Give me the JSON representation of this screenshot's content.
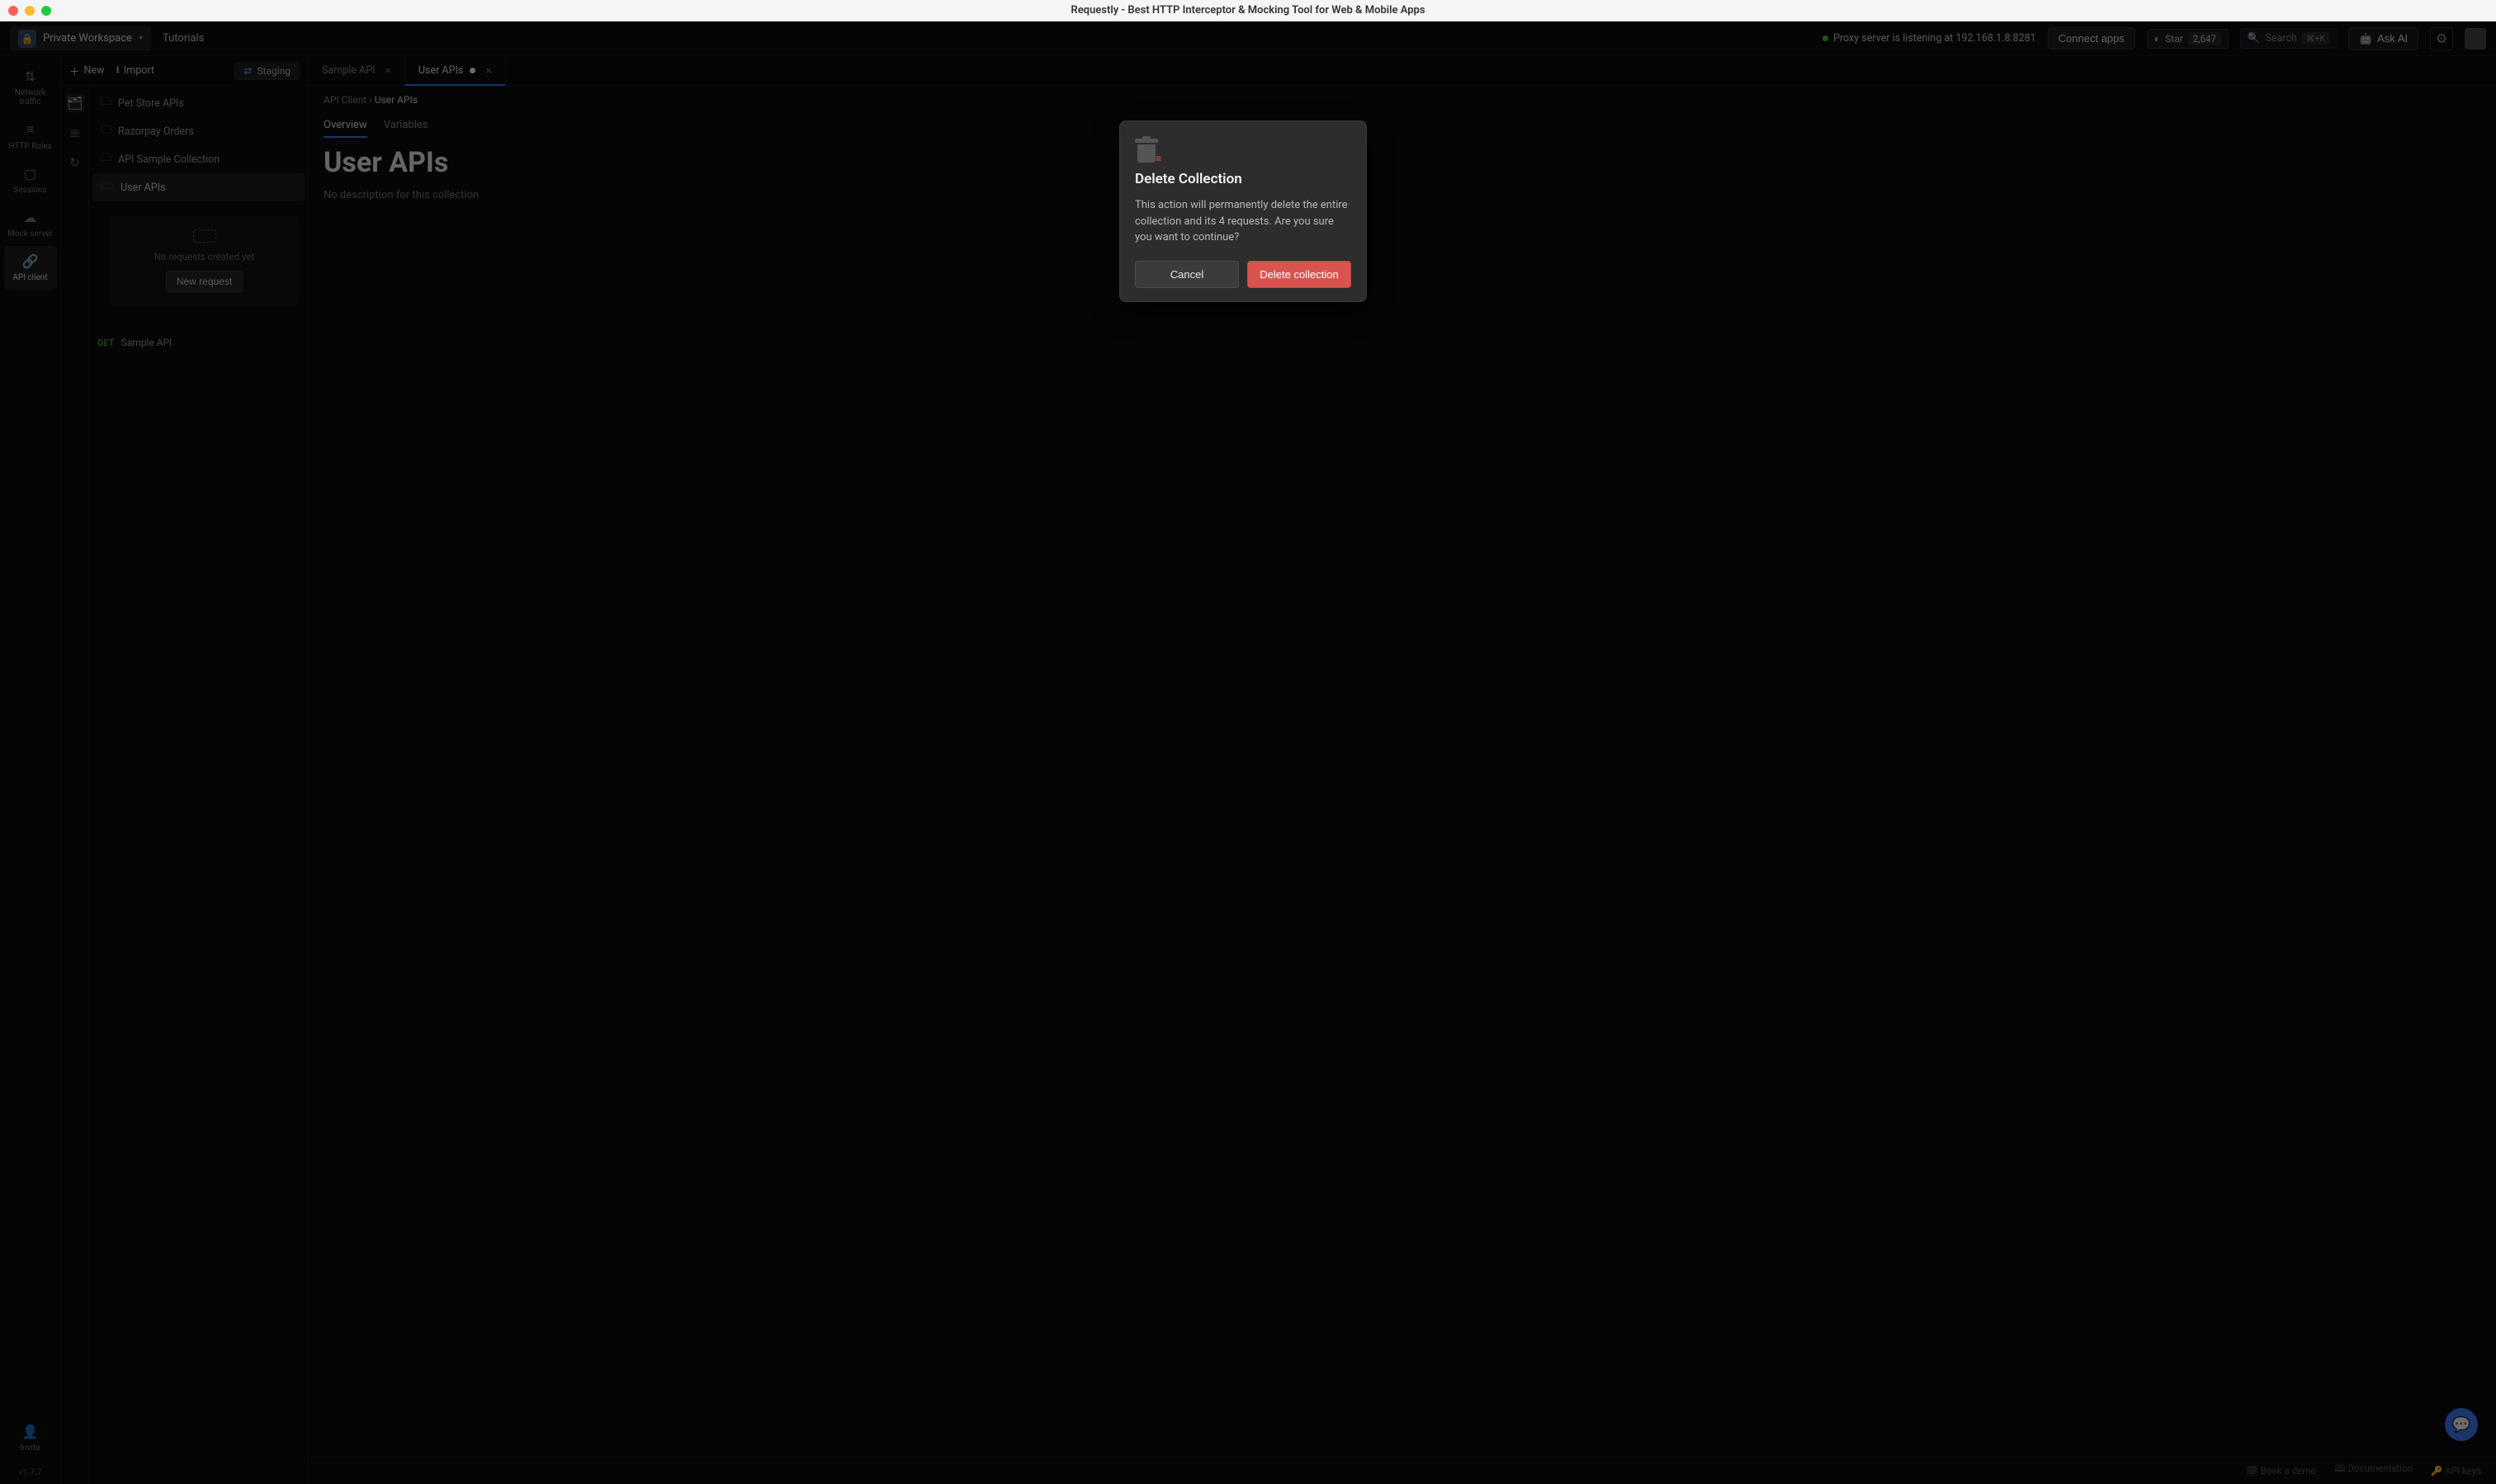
{
  "window": {
    "title": "Requestly - Best HTTP Interceptor & Mocking Tool for Web & Mobile Apps"
  },
  "header": {
    "workspace": "Private Workspace",
    "tutorials": "Tutorials",
    "proxy_status": "Proxy server is listening at 192.168.1.8:8281",
    "connect_apps": "Connect apps",
    "github_star": "Star",
    "github_count": "2,647",
    "search_placeholder": "Search",
    "search_shortcut": "⌘+K",
    "ask_ai": "Ask AI"
  },
  "globalnav": {
    "network": "Network traffic",
    "rules": "HTTP Rules",
    "sessions": "Sessions",
    "mock": "Mock server",
    "api_client": "API client",
    "invite": "Invite",
    "version": "v1.7.7"
  },
  "side2": {
    "new_label": "New",
    "import_label": "Import",
    "env_label": "Staging",
    "collections": {
      "petstore": "Pet Store APIs",
      "razorpay": "Razorpay Orders",
      "sample": "API Sample Collection",
      "userapis": "User APIs"
    },
    "empty_msg": "No requests created yet",
    "new_request": "New request",
    "sample_api_method": "GET",
    "sample_api_name": "Sample API"
  },
  "tabs": {
    "sample_api": "Sample API",
    "user_apis": "User APIs"
  },
  "main": {
    "crumb_root": "API Client",
    "crumb_leaf": "User APIs",
    "subtab_overview": "Overview",
    "subtab_variables": "Variables",
    "heading": "User APIs",
    "description": "No description for this collection"
  },
  "footer": {
    "demo": "Book a demo",
    "docs": "Documentation",
    "apikeys": "API keys"
  },
  "modal": {
    "title": "Delete Collection",
    "body": "This action will permanently delete the entire collection and its 4 requests. Are you sure you want to continue?",
    "cancel": "Cancel",
    "confirm": "Delete collection"
  }
}
